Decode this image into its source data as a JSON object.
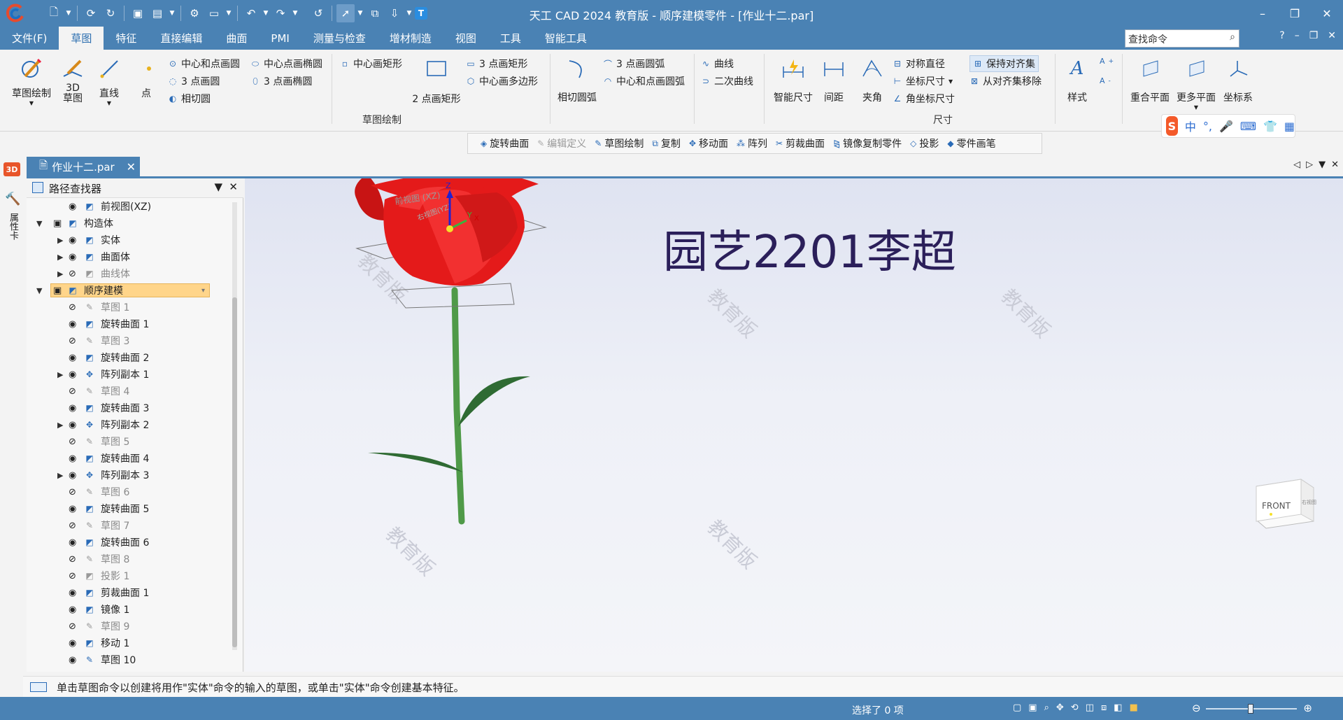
{
  "window": {
    "title": "天工 CAD 2024 教育版 - 顺序建模零件 - [作业十二.par]",
    "controls": [
      "–",
      "❐",
      "✕"
    ]
  },
  "quick_access": [
    "new-icon",
    "open-icon",
    "save-icon",
    "save-as-icon",
    "settings-icon",
    "undo-icon",
    "redo-icon",
    "select-icon",
    "text-icon"
  ],
  "menu": {
    "tabs": [
      "文件(F)",
      "草图",
      "特征",
      "直接编辑",
      "曲面",
      "PMI",
      "测量与检查",
      "增材制造",
      "视图",
      "工具",
      "智能工具"
    ],
    "active_tab": "草图",
    "search_placeholder": "查找命令",
    "right_icons": [
      "?",
      "–",
      "❐",
      "✕"
    ]
  },
  "ribbon": {
    "sketch_draw": "草图绘制",
    "sketch_3d": "3D\n草图",
    "line": "直线",
    "point": "点",
    "center_point_circle": "中心和点画圆",
    "center_point_ellipse": "中心点画椭圆",
    "three_point_circle": "3 点画圆",
    "three_point_ellipse": "3 点画椭圆",
    "tangent_circle": "相切圆",
    "center_rect": "中心画矩形",
    "two_point_rect": "2 点画矩形",
    "three_point_rect": "3 点画矩形",
    "center_polygon": "中心画多边形",
    "tangent_arc": "相切圆弧",
    "three_point_arc": "3 点画圆弧",
    "center_point_arc": "中心和点画圆弧",
    "curve": "曲线",
    "conic": "二次曲线",
    "group_sketch": "草图绘制",
    "smart_dim": "智能尺寸",
    "spacing": "间距",
    "angle": "夹角",
    "sym_diameter": "对称直径",
    "coord_dim": "坐标尺寸",
    "angle_coord_dim": "角坐标尺寸",
    "group_dim": "尺寸",
    "keep_align": "保持对齐集",
    "remove_align": "从对齐集移除",
    "style": "样式",
    "coincident_plane": "重合平面",
    "more_planes": "更多平面",
    "coord_system": "坐标系"
  },
  "ime": {
    "logo": "S",
    "lang": "中"
  },
  "command_bar": [
    {
      "label": "旋转曲面",
      "enabled": true
    },
    {
      "label": "编辑定义",
      "enabled": false
    },
    {
      "label": "草图绘制",
      "enabled": true
    },
    {
      "label": "复制",
      "enabled": true
    },
    {
      "label": "移动面",
      "enabled": true
    },
    {
      "label": "阵列",
      "enabled": true
    },
    {
      "label": "剪裁曲面",
      "enabled": true
    },
    {
      "label": "镜像复制零件",
      "enabled": true
    },
    {
      "label": "投影",
      "enabled": true
    },
    {
      "label": "零件画笔",
      "enabled": true
    }
  ],
  "doc_tab": {
    "label": "作业十二.par"
  },
  "left_strip": {
    "badge": "3D",
    "label": "属性卡"
  },
  "pathfinder": {
    "title": "路径查找器",
    "items": [
      {
        "label": "前视图(XZ)",
        "level": 2,
        "dim": false,
        "expander": "",
        "hidden": false
      },
      {
        "label": "构造体",
        "level": 0,
        "dim": false,
        "expander": "▼",
        "hidden": false
      },
      {
        "label": "实体",
        "level": 1,
        "dim": false,
        "expander": "▶",
        "hidden": false
      },
      {
        "label": "曲面体",
        "level": 1,
        "dim": false,
        "expander": "▶",
        "hidden": false
      },
      {
        "label": "曲线体",
        "level": 1,
        "dim": true,
        "expander": "▶",
        "hidden": true
      },
      {
        "label": "顺序建模",
        "level": 0,
        "dim": false,
        "expander": "▼",
        "hidden": false,
        "highlight": true
      },
      {
        "label": "草图 1",
        "level": 2,
        "dim": true,
        "expander": "",
        "hidden": true
      },
      {
        "label": "旋转曲面 1",
        "level": 2,
        "dim": false,
        "expander": "",
        "hidden": false
      },
      {
        "label": "草图 3",
        "level": 2,
        "dim": true,
        "expander": "",
        "hidden": true
      },
      {
        "label": "旋转曲面 2",
        "level": 2,
        "dim": false,
        "expander": "",
        "hidden": false
      },
      {
        "label": "阵列副本 1",
        "level": 2,
        "dim": false,
        "expander": "▶",
        "hidden": false
      },
      {
        "label": "草图 4",
        "level": 2,
        "dim": true,
        "expander": "",
        "hidden": true
      },
      {
        "label": "旋转曲面 3",
        "level": 2,
        "dim": false,
        "expander": "",
        "hidden": false
      },
      {
        "label": "阵列副本 2",
        "level": 2,
        "dim": false,
        "expander": "▶",
        "hidden": false
      },
      {
        "label": "草图 5",
        "level": 2,
        "dim": true,
        "expander": "",
        "hidden": true
      },
      {
        "label": "旋转曲面 4",
        "level": 2,
        "dim": false,
        "expander": "",
        "hidden": false
      },
      {
        "label": "阵列副本 3",
        "level": 2,
        "dim": false,
        "expander": "▶",
        "hidden": false
      },
      {
        "label": "草图 6",
        "level": 2,
        "dim": true,
        "expander": "",
        "hidden": true
      },
      {
        "label": "旋转曲面 5",
        "level": 2,
        "dim": false,
        "expander": "",
        "hidden": false
      },
      {
        "label": "草图 7",
        "level": 2,
        "dim": true,
        "expander": "",
        "hidden": true
      },
      {
        "label": "旋转曲面 6",
        "level": 2,
        "dim": false,
        "expander": "",
        "hidden": false
      },
      {
        "label": "草图 8",
        "level": 2,
        "dim": true,
        "expander": "",
        "hidden": true
      },
      {
        "label": "投影 1",
        "level": 2,
        "dim": true,
        "expander": "",
        "hidden": true
      },
      {
        "label": "剪裁曲面 1",
        "level": 2,
        "dim": false,
        "expander": "",
        "hidden": false
      },
      {
        "label": "镜像 1",
        "level": 2,
        "dim": false,
        "expander": "",
        "hidden": false
      },
      {
        "label": "草图 9",
        "level": 2,
        "dim": true,
        "expander": "",
        "hidden": true
      },
      {
        "label": "移动 1",
        "level": 2,
        "dim": false,
        "expander": "",
        "hidden": false
      },
      {
        "label": "草图 10",
        "level": 2,
        "dim": false,
        "expander": "",
        "hidden": false
      }
    ]
  },
  "viewport": {
    "annotation": "园艺2201李超",
    "watermark": "教育版",
    "view_cube": "FRONT",
    "view_cube_side": "右视图",
    "ref_plane_label_1": "前视图 (XZ)",
    "ref_plane_label_2": "右视图(YZ)",
    "axis_z": "Z",
    "axis_y": "Y",
    "axis_x": "X",
    "colors": {
      "petal": "#e41a1a",
      "stem": "#4f9a48",
      "leaf": "#2f6b33",
      "annotation": "#2b1f5a"
    }
  },
  "status": {
    "message": "单击草图命令以创建将用作\"实体\"命令的输入的草图，或单击\"实体\"命令创建基本特征。",
    "selection": "选择了 0 项"
  }
}
